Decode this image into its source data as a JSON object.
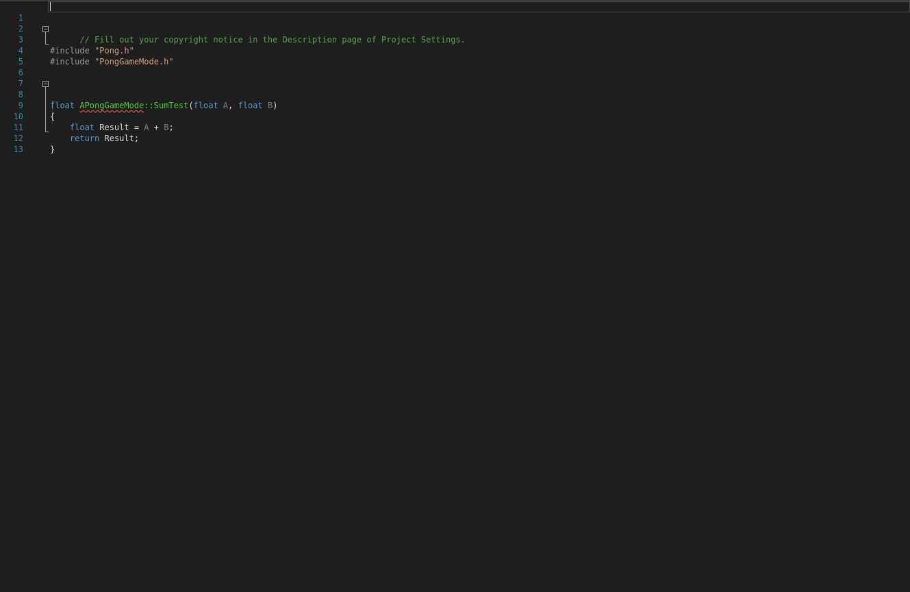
{
  "editor": {
    "line_numbers": [
      "1",
      "2",
      "3",
      "4",
      "5",
      "6",
      "7",
      "8",
      "9",
      "10",
      "11",
      "12",
      "13"
    ],
    "lines": {
      "l1": {
        "comment": "// Fill out your copyright notice in the Description page of Project Settings."
      },
      "l3": {
        "directive": "#include",
        "space": " ",
        "path": "\"Pong.h\""
      },
      "l4": {
        "directive": "#include",
        "space": " ",
        "path": "\"PongGameMode.h\""
      },
      "l8": {
        "ret_type": "float",
        "class_name": "APongGameMode",
        "scope": "::",
        "func_name": "SumTest",
        "open_paren": "(",
        "p1_type": "float",
        "p1_name": "A",
        "comma": ", ",
        "p2_type": "float",
        "p2_name": "B",
        "close_paren": ")"
      },
      "l9": {
        "brace": "{"
      },
      "l10": {
        "indent": "    ",
        "type": "float",
        "var": " Result = ",
        "a": "A",
        "op": " + ",
        "b": "B",
        "end": ";"
      },
      "l11": {
        "indent": "    ",
        "kw": "return",
        "rest": " Result;"
      },
      "l12": {
        "brace": "}"
      }
    }
  },
  "colors": {
    "background": "#1e1e1e",
    "line_number": "#2b91af",
    "comment": "#57a64a",
    "keyword": "#569cd6",
    "string": "#d69d85",
    "function": "#4fd13b",
    "parameter": "#7f7f7f",
    "error_squiggle": "#f14c4c"
  },
  "icons": [
    "collapse-icon"
  ]
}
